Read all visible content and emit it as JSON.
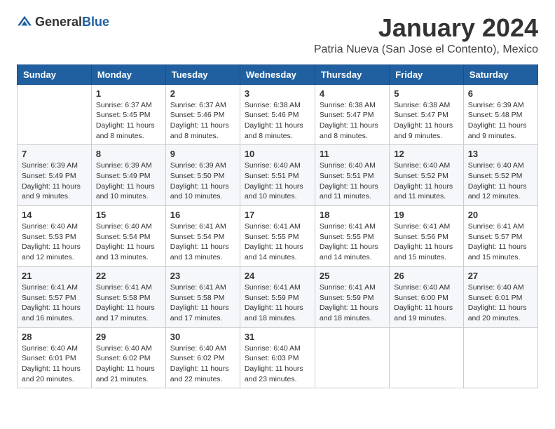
{
  "logo": {
    "text_general": "General",
    "text_blue": "Blue"
  },
  "header": {
    "month_title": "January 2024",
    "subtitle": "Patria Nueva (San Jose el Contento), Mexico"
  },
  "days_of_week": [
    "Sunday",
    "Monday",
    "Tuesday",
    "Wednesday",
    "Thursday",
    "Friday",
    "Saturday"
  ],
  "weeks": [
    [
      {
        "day": "",
        "info": ""
      },
      {
        "day": "1",
        "info": "Sunrise: 6:37 AM\nSunset: 5:45 PM\nDaylight: 11 hours\nand 8 minutes."
      },
      {
        "day": "2",
        "info": "Sunrise: 6:37 AM\nSunset: 5:46 PM\nDaylight: 11 hours\nand 8 minutes."
      },
      {
        "day": "3",
        "info": "Sunrise: 6:38 AM\nSunset: 5:46 PM\nDaylight: 11 hours\nand 8 minutes."
      },
      {
        "day": "4",
        "info": "Sunrise: 6:38 AM\nSunset: 5:47 PM\nDaylight: 11 hours\nand 8 minutes."
      },
      {
        "day": "5",
        "info": "Sunrise: 6:38 AM\nSunset: 5:47 PM\nDaylight: 11 hours\nand 9 minutes."
      },
      {
        "day": "6",
        "info": "Sunrise: 6:39 AM\nSunset: 5:48 PM\nDaylight: 11 hours\nand 9 minutes."
      }
    ],
    [
      {
        "day": "7",
        "info": "Sunrise: 6:39 AM\nSunset: 5:49 PM\nDaylight: 11 hours\nand 9 minutes."
      },
      {
        "day": "8",
        "info": "Sunrise: 6:39 AM\nSunset: 5:49 PM\nDaylight: 11 hours\nand 10 minutes."
      },
      {
        "day": "9",
        "info": "Sunrise: 6:39 AM\nSunset: 5:50 PM\nDaylight: 11 hours\nand 10 minutes."
      },
      {
        "day": "10",
        "info": "Sunrise: 6:40 AM\nSunset: 5:51 PM\nDaylight: 11 hours\nand 10 minutes."
      },
      {
        "day": "11",
        "info": "Sunrise: 6:40 AM\nSunset: 5:51 PM\nDaylight: 11 hours\nand 11 minutes."
      },
      {
        "day": "12",
        "info": "Sunrise: 6:40 AM\nSunset: 5:52 PM\nDaylight: 11 hours\nand 11 minutes."
      },
      {
        "day": "13",
        "info": "Sunrise: 6:40 AM\nSunset: 5:52 PM\nDaylight: 11 hours\nand 12 minutes."
      }
    ],
    [
      {
        "day": "14",
        "info": "Sunrise: 6:40 AM\nSunset: 5:53 PM\nDaylight: 11 hours\nand 12 minutes."
      },
      {
        "day": "15",
        "info": "Sunrise: 6:40 AM\nSunset: 5:54 PM\nDaylight: 11 hours\nand 13 minutes."
      },
      {
        "day": "16",
        "info": "Sunrise: 6:41 AM\nSunset: 5:54 PM\nDaylight: 11 hours\nand 13 minutes."
      },
      {
        "day": "17",
        "info": "Sunrise: 6:41 AM\nSunset: 5:55 PM\nDaylight: 11 hours\nand 14 minutes."
      },
      {
        "day": "18",
        "info": "Sunrise: 6:41 AM\nSunset: 5:55 PM\nDaylight: 11 hours\nand 14 minutes."
      },
      {
        "day": "19",
        "info": "Sunrise: 6:41 AM\nSunset: 5:56 PM\nDaylight: 11 hours\nand 15 minutes."
      },
      {
        "day": "20",
        "info": "Sunrise: 6:41 AM\nSunset: 5:57 PM\nDaylight: 11 hours\nand 15 minutes."
      }
    ],
    [
      {
        "day": "21",
        "info": "Sunrise: 6:41 AM\nSunset: 5:57 PM\nDaylight: 11 hours\nand 16 minutes."
      },
      {
        "day": "22",
        "info": "Sunrise: 6:41 AM\nSunset: 5:58 PM\nDaylight: 11 hours\nand 17 minutes."
      },
      {
        "day": "23",
        "info": "Sunrise: 6:41 AM\nSunset: 5:58 PM\nDaylight: 11 hours\nand 17 minutes."
      },
      {
        "day": "24",
        "info": "Sunrise: 6:41 AM\nSunset: 5:59 PM\nDaylight: 11 hours\nand 18 minutes."
      },
      {
        "day": "25",
        "info": "Sunrise: 6:41 AM\nSunset: 5:59 PM\nDaylight: 11 hours\nand 18 minutes."
      },
      {
        "day": "26",
        "info": "Sunrise: 6:40 AM\nSunset: 6:00 PM\nDaylight: 11 hours\nand 19 minutes."
      },
      {
        "day": "27",
        "info": "Sunrise: 6:40 AM\nSunset: 6:01 PM\nDaylight: 11 hours\nand 20 minutes."
      }
    ],
    [
      {
        "day": "28",
        "info": "Sunrise: 6:40 AM\nSunset: 6:01 PM\nDaylight: 11 hours\nand 20 minutes."
      },
      {
        "day": "29",
        "info": "Sunrise: 6:40 AM\nSunset: 6:02 PM\nDaylight: 11 hours\nand 21 minutes."
      },
      {
        "day": "30",
        "info": "Sunrise: 6:40 AM\nSunset: 6:02 PM\nDaylight: 11 hours\nand 22 minutes."
      },
      {
        "day": "31",
        "info": "Sunrise: 6:40 AM\nSunset: 6:03 PM\nDaylight: 11 hours\nand 23 minutes."
      },
      {
        "day": "",
        "info": ""
      },
      {
        "day": "",
        "info": ""
      },
      {
        "day": "",
        "info": ""
      }
    ]
  ]
}
